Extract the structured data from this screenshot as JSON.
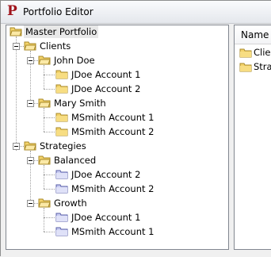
{
  "window": {
    "title": "Portfolio Editor",
    "app_icon_letter": "P"
  },
  "tree": {
    "root": "Master Portfolio",
    "clients": "Clients",
    "john_doe": "John Doe",
    "jdoe_account_1": "JDoe Account 1",
    "jdoe_account_2": "JDoe Account 2",
    "mary_smith": "Mary Smith",
    "msmith_account_1": "MSmith Account 1",
    "msmith_account_2": "MSmith Account 2",
    "strategies": "Strategies",
    "balanced": "Balanced",
    "balanced_jdoe_account_2": "JDoe Account 2",
    "balanced_msmith_account_2": "MSmith Account 2",
    "growth": "Growth",
    "growth_jdoe_account_1": "JDoe Account 1",
    "growth_msmith_account_1": "MSmith Account 1"
  },
  "list": {
    "column_name": "Name",
    "items": [
      "Clients",
      "Strategies"
    ]
  },
  "colors": {
    "folder_yellow": "#f3d36b",
    "folder_blue": "#c9cdf2",
    "selection": "#e8e8e8"
  }
}
